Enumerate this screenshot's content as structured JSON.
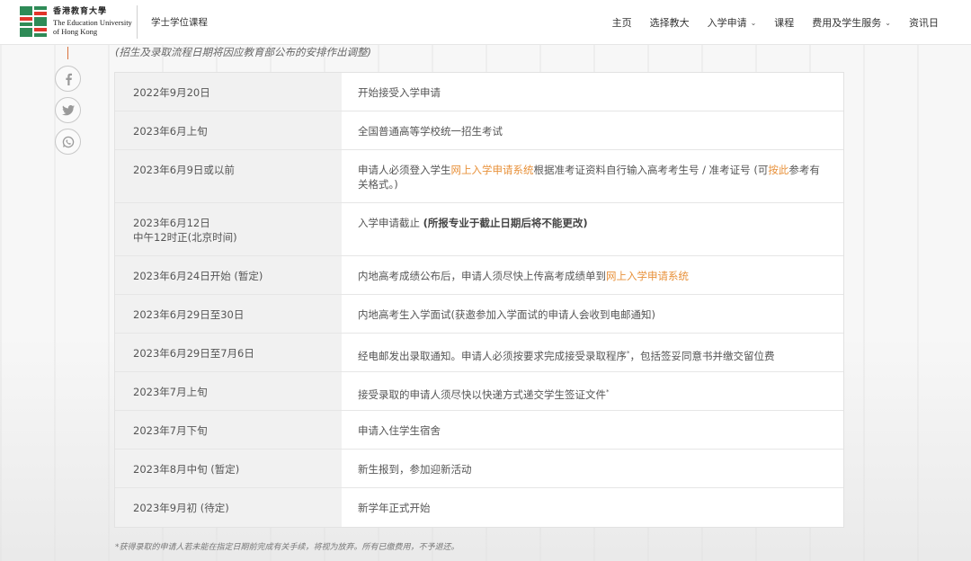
{
  "header": {
    "logo_cn": "香港教育大學",
    "logo_en_line1": "The Education University",
    "logo_en_line2": "of Hong Kong",
    "subtitle": "学士学位课程",
    "nav": [
      {
        "label": "主页",
        "has_dropdown": false
      },
      {
        "label": "选择教大",
        "has_dropdown": false
      },
      {
        "label": "入学申请",
        "has_dropdown": true
      },
      {
        "label": "课程",
        "has_dropdown": false
      },
      {
        "label": "费用及学生服务",
        "has_dropdown": true
      },
      {
        "label": "资讯日",
        "has_dropdown": false
      }
    ]
  },
  "note": "(招生及录取流程日期将因应教育部公布的安排作出调整)",
  "social": [
    "facebook-icon",
    "twitter-icon",
    "whatsapp-icon"
  ],
  "colors": {
    "link": "#e8913a",
    "accent_red": "#d9703c"
  },
  "rows": [
    {
      "date": "2022年9月20日",
      "event": "开始接受入学申请"
    },
    {
      "date": "2023年6月上旬",
      "event": "全国普通高等学校统一招生考试"
    },
    {
      "date": "2023年6月9日或以前",
      "event_pre": "申请人必须登入学生",
      "event_link": "网上入学申请系统",
      "event_mid": "根据准考证资料自行输入高考考生号 / 准考证号 (可",
      "event_link2": "按此",
      "event_post": "参考有关格式。)"
    },
    {
      "date": "2023年6月12日",
      "date_line2": "中午12时正(北京时间)",
      "event_pre": "入学申请截止 ",
      "event_bold": "(所报专业于截止日期后将不能更改)"
    },
    {
      "date": "2023年6月24日开始 (暂定)",
      "event_pre": "内地高考成绩公布后，申请人须尽快上传高考成绩单到",
      "event_link": "网上入学申请系统"
    },
    {
      "date": "2023年6月29日至30日",
      "event": "内地高考生入学面试(获邀参加入学面试的申请人会收到电邮通知)"
    },
    {
      "date": "2023年6月29日至7月6日",
      "event_pre": "经电邮发出录取通知。申请人必须按要求完成接受录取程序",
      "event_sup": "*",
      "event_post": "，包括签妥同意书并缴交留位费"
    },
    {
      "date": "2023年7月上旬",
      "event_pre": "接受录取的申请人须尽快以快递方式递交学生签证文件",
      "event_sup": "*"
    },
    {
      "date": "2023年7月下旬",
      "event": "申请入住学生宿舍"
    },
    {
      "date": "2023年8月中旬 (暂定)",
      "event": "新生报到，参加迎新活动"
    },
    {
      "date": "2023年9月初 (待定)",
      "event": "新学年正式开始"
    }
  ],
  "footnote": "*获得录取的申请人若未能在指定日期前完成有关手续，将视为放弃。所有已缴费用，不予退还。"
}
